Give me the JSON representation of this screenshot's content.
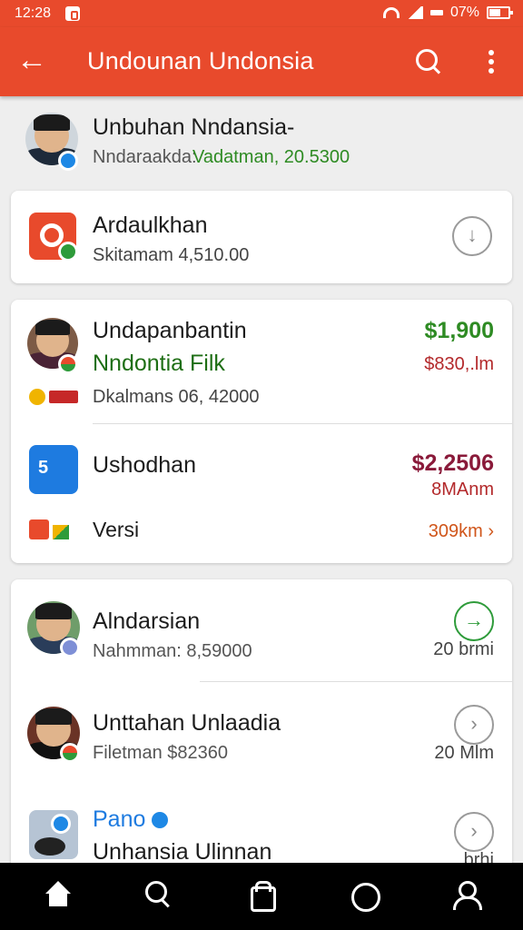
{
  "status_bar": {
    "time": "12:28",
    "battery": "07%"
  },
  "app_bar": {
    "title": "Undounan Undonsia"
  },
  "profile": {
    "name": "Unbuhan Nndansia-",
    "subtitle_prefix": "Nndaraakda:",
    "subtitle_value": "Vadatman, 20.5300"
  },
  "featured": {
    "title": "Ardaulkhan",
    "subtitle": "Skitamam 4,510.00"
  },
  "group1": {
    "item1": {
      "title": "Undapanbantin",
      "subtitle": "Nndontia Filk",
      "meta": "Dkalmans 06, 42000",
      "amount": "$1,900",
      "secondary": "$830,.lm"
    },
    "item2": {
      "title": "Ushodhan",
      "amount": "$2,2506",
      "secondary": "8MAnm",
      "tag": "Versi",
      "link": "309km"
    }
  },
  "group2": {
    "item1": {
      "title": "Alndarsian",
      "subtitle": "Nahmman: 8,59000",
      "side": "20 brmi"
    },
    "item2": {
      "title": "Unttahan Unlaadia",
      "subtitle": "Filetman $82360",
      "side": "20 Mlm"
    },
    "item3": {
      "title": "Pano",
      "subtitle": "Unhansia Ulinnan",
      "side": "brhi"
    }
  },
  "colors": {
    "app_bar": "#e84a2c",
    "positive": "#2e8b23",
    "negative": "#b3292b"
  }
}
